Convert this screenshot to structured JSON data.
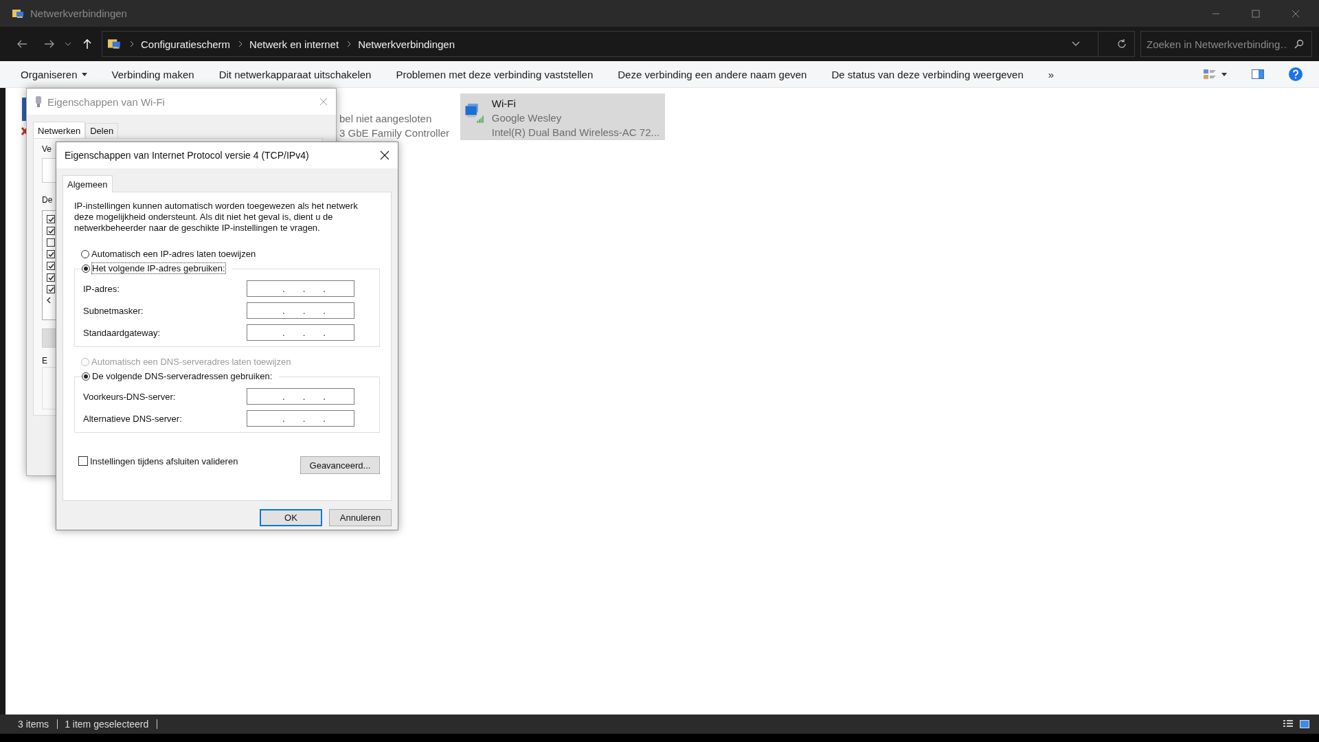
{
  "window": {
    "title": "Netwerkverbindingen"
  },
  "navigation": {
    "breadcrumb": [
      "Configuratiescherm",
      "Netwerk en internet",
      "Netwerkverbindingen"
    ],
    "search": {
      "placeholder": "Zoeken in Netwerkverbinding…"
    }
  },
  "command_bar": {
    "items": [
      "Organiseren",
      "Verbinding maken",
      "Dit netwerkapparaat uitschakelen",
      "Problemen met deze verbinding vaststellen",
      "Deze verbinding een andere naam geven",
      "De status van deze verbinding weergeven"
    ],
    "overflow": "»"
  },
  "connections": [
    {
      "kind": "partial",
      "lines": [
        "bel niet aangesloten",
        "3 GbE Family Controller"
      ],
      "selected": false
    },
    {
      "kind": "full",
      "name": "Wi-Fi",
      "network": "Google Wesley",
      "adapter": "Intel(R) Dual Band Wireless-AC 72...",
      "selected": true
    }
  ],
  "wifi_dialog": {
    "title": "Eigenschappen van Wi-Fi",
    "tabs": [
      {
        "label": "Netwerken",
        "selected": true
      },
      {
        "label": "Delen",
        "selected": false
      }
    ],
    "fragments": [
      "Ve",
      "De",
      "E"
    ],
    "components": [
      {
        "checked": true
      },
      {
        "checked": true
      },
      {
        "checked": false
      },
      {
        "checked": true
      },
      {
        "checked": true
      },
      {
        "checked": true
      },
      {
        "checked": true
      }
    ]
  },
  "ipv4_dialog": {
    "title": "Eigenschappen van Internet Protocol versie 4 (TCP/IPv4)",
    "tabs": [
      {
        "label": "Algemeen",
        "selected": true
      }
    ],
    "description": "IP-instellingen kunnen automatisch worden toegewezen als het netwerk deze mogelijkheid ondersteunt. Als dit niet het geval is, dient u de netwerkbeheerder naar de geschikte IP-instellingen te vragen.",
    "ip_separator": ".",
    "ip_modes": [
      {
        "label": "Automatisch een IP-adres laten toewijzen",
        "selected": false,
        "disabled": false
      },
      {
        "label": "Het volgende IP-adres gebruiken:",
        "selected": true,
        "disabled": false
      }
    ],
    "ip_fields": [
      {
        "label": "IP-adres:"
      },
      {
        "label": "Subnetmasker:"
      },
      {
        "label": "Standaardgateway:"
      }
    ],
    "dns_modes": [
      {
        "label": "Automatisch een DNS-serveradres laten toewijzen",
        "selected": false,
        "disabled": true
      },
      {
        "label": "De volgende DNS-serveradressen gebruiken:",
        "selected": true,
        "disabled": false
      }
    ],
    "dns_fields": [
      {
        "label": "Voorkeurs-DNS-server:"
      },
      {
        "label": "Alternatieve DNS-server:"
      }
    ],
    "validate": {
      "label": "Instellingen tijdens afsluiten valideren",
      "checked": false
    },
    "advanced_button": "Geavanceerd...",
    "buttons": [
      {
        "label": "OK",
        "default": true
      },
      {
        "label": "Annuleren",
        "default": false
      }
    ]
  },
  "status_bar": {
    "items": [
      "3 items",
      "1 item geselecteerd"
    ]
  }
}
